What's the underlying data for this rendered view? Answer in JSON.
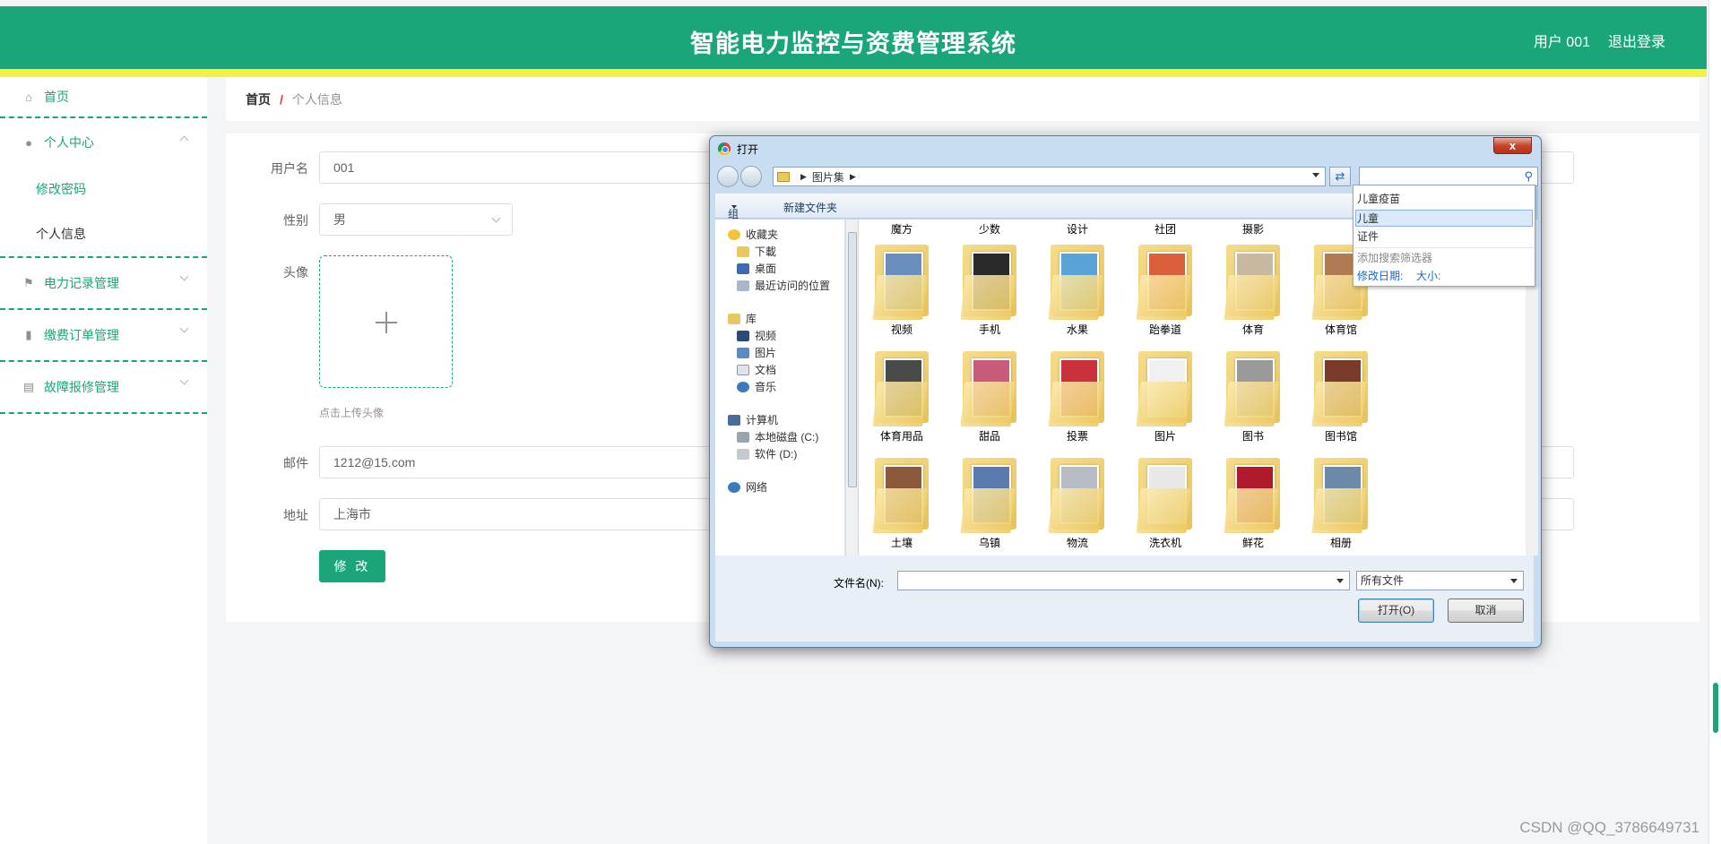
{
  "header": {
    "title": "智能电力监控与资费管理系统",
    "user": "用户 001",
    "logout": "退出登录"
  },
  "sidebar": {
    "home": "首页",
    "personal_center": "个人中心",
    "change_password": "修改密码",
    "personal_info": "个人信息",
    "power_records": "电力记录管理",
    "payment_orders": "缴费订单管理",
    "repair": "故障报修管理"
  },
  "breadcrumb": {
    "home": "首页",
    "separator": "/",
    "current": "个人信息"
  },
  "form": {
    "username_label": "用户名",
    "username": "001",
    "gender_label": "性别",
    "gender": "男",
    "avatar_label": "头像",
    "upload_tip": "点击上传头像",
    "email_label": "邮件",
    "email": "1212@15.com",
    "address_label": "地址",
    "address": "上海市",
    "submit": "修 改"
  },
  "dialog": {
    "title": "打开",
    "close": "x",
    "path": "图片集",
    "toolbar": {
      "organize": "组织",
      "new_folder": "新建文件夹"
    },
    "nav": {
      "favorites": "收藏夹",
      "downloads": "下載",
      "desktop": "桌面",
      "recent": "最近访问的位置",
      "library": "库",
      "videos": "视频",
      "pictures": "图片",
      "documents": "文档",
      "music": "音乐",
      "computer": "计算机",
      "disk_c": "本地磁盘 (C:)",
      "disk_d": "软件 (D:)",
      "network": "网络"
    },
    "top_labels": [
      "魔方",
      "少数",
      "设计",
      "社团",
      "摄影",
      ""
    ],
    "folders": [
      {
        "label": "视频",
        "color": "#6a8fbf"
      },
      {
        "label": "手机",
        "color": "#2a2a2a"
      },
      {
        "label": "水果",
        "color": "#5aa3d6"
      },
      {
        "label": "跆拳道",
        "color": "#d9603a"
      },
      {
        "label": "体育",
        "color": "#c9b8a0"
      },
      {
        "label": "体育馆",
        "color": "#b07a52"
      },
      {
        "label": "体育用品",
        "color": "#4a4a4a"
      },
      {
        "label": "甜品",
        "color": "#c85a7a"
      },
      {
        "label": "投票",
        "color": "#c8303a"
      },
      {
        "label": "图片",
        "color": "#f0f0f0"
      },
      {
        "label": "图书",
        "color": "#9a9a9a"
      },
      {
        "label": "图书馆",
        "color": "#7a3a2a"
      },
      {
        "label": "土壤",
        "color": "#8a5a3a"
      },
      {
        "label": "乌镇",
        "color": "#5a7ab0"
      },
      {
        "label": "物流",
        "color": "#b8bcc4"
      },
      {
        "label": "洗衣机",
        "color": "#e8e8e8"
      },
      {
        "label": "鲜花",
        "color": "#b01a2a"
      },
      {
        "label": "相册",
        "color": "#6a8aa8"
      }
    ],
    "filename_label": "文件名(N):",
    "filename": "",
    "filetype": "所有文件",
    "open": "打开(O)",
    "cancel": "取消"
  },
  "suggest": {
    "items": [
      "儿童疫苗",
      "儿童",
      "证件"
    ],
    "add_filter": "添加搜索筛选器",
    "modified_date": "修改日期:",
    "size": "大小:"
  },
  "watermark": "CSDN @QQ_3786649731"
}
